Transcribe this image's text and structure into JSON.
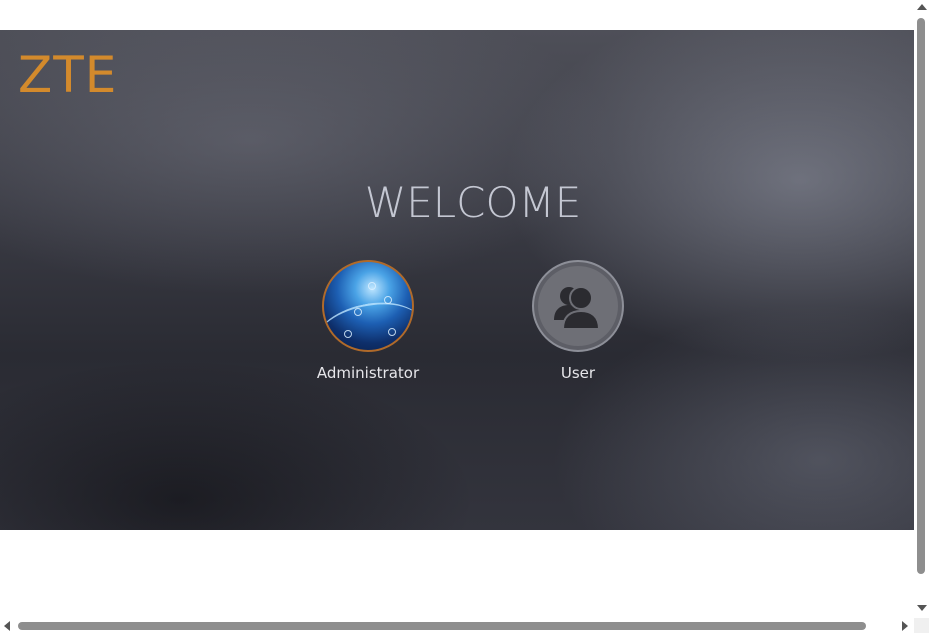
{
  "brand": {
    "logo_text": "ZTE",
    "logo_color": "#d38a2c"
  },
  "welcome": {
    "heading": "WELCOME"
  },
  "roles": [
    {
      "label": "Administrator",
      "icon": "admin-avatar-icon"
    },
    {
      "label": "User",
      "icon": "user-group-icon"
    }
  ],
  "colors": {
    "banner_base": "#3b3c45",
    "heading_color": "#c4c7d2",
    "admin_ring": "#b06a2a"
  }
}
